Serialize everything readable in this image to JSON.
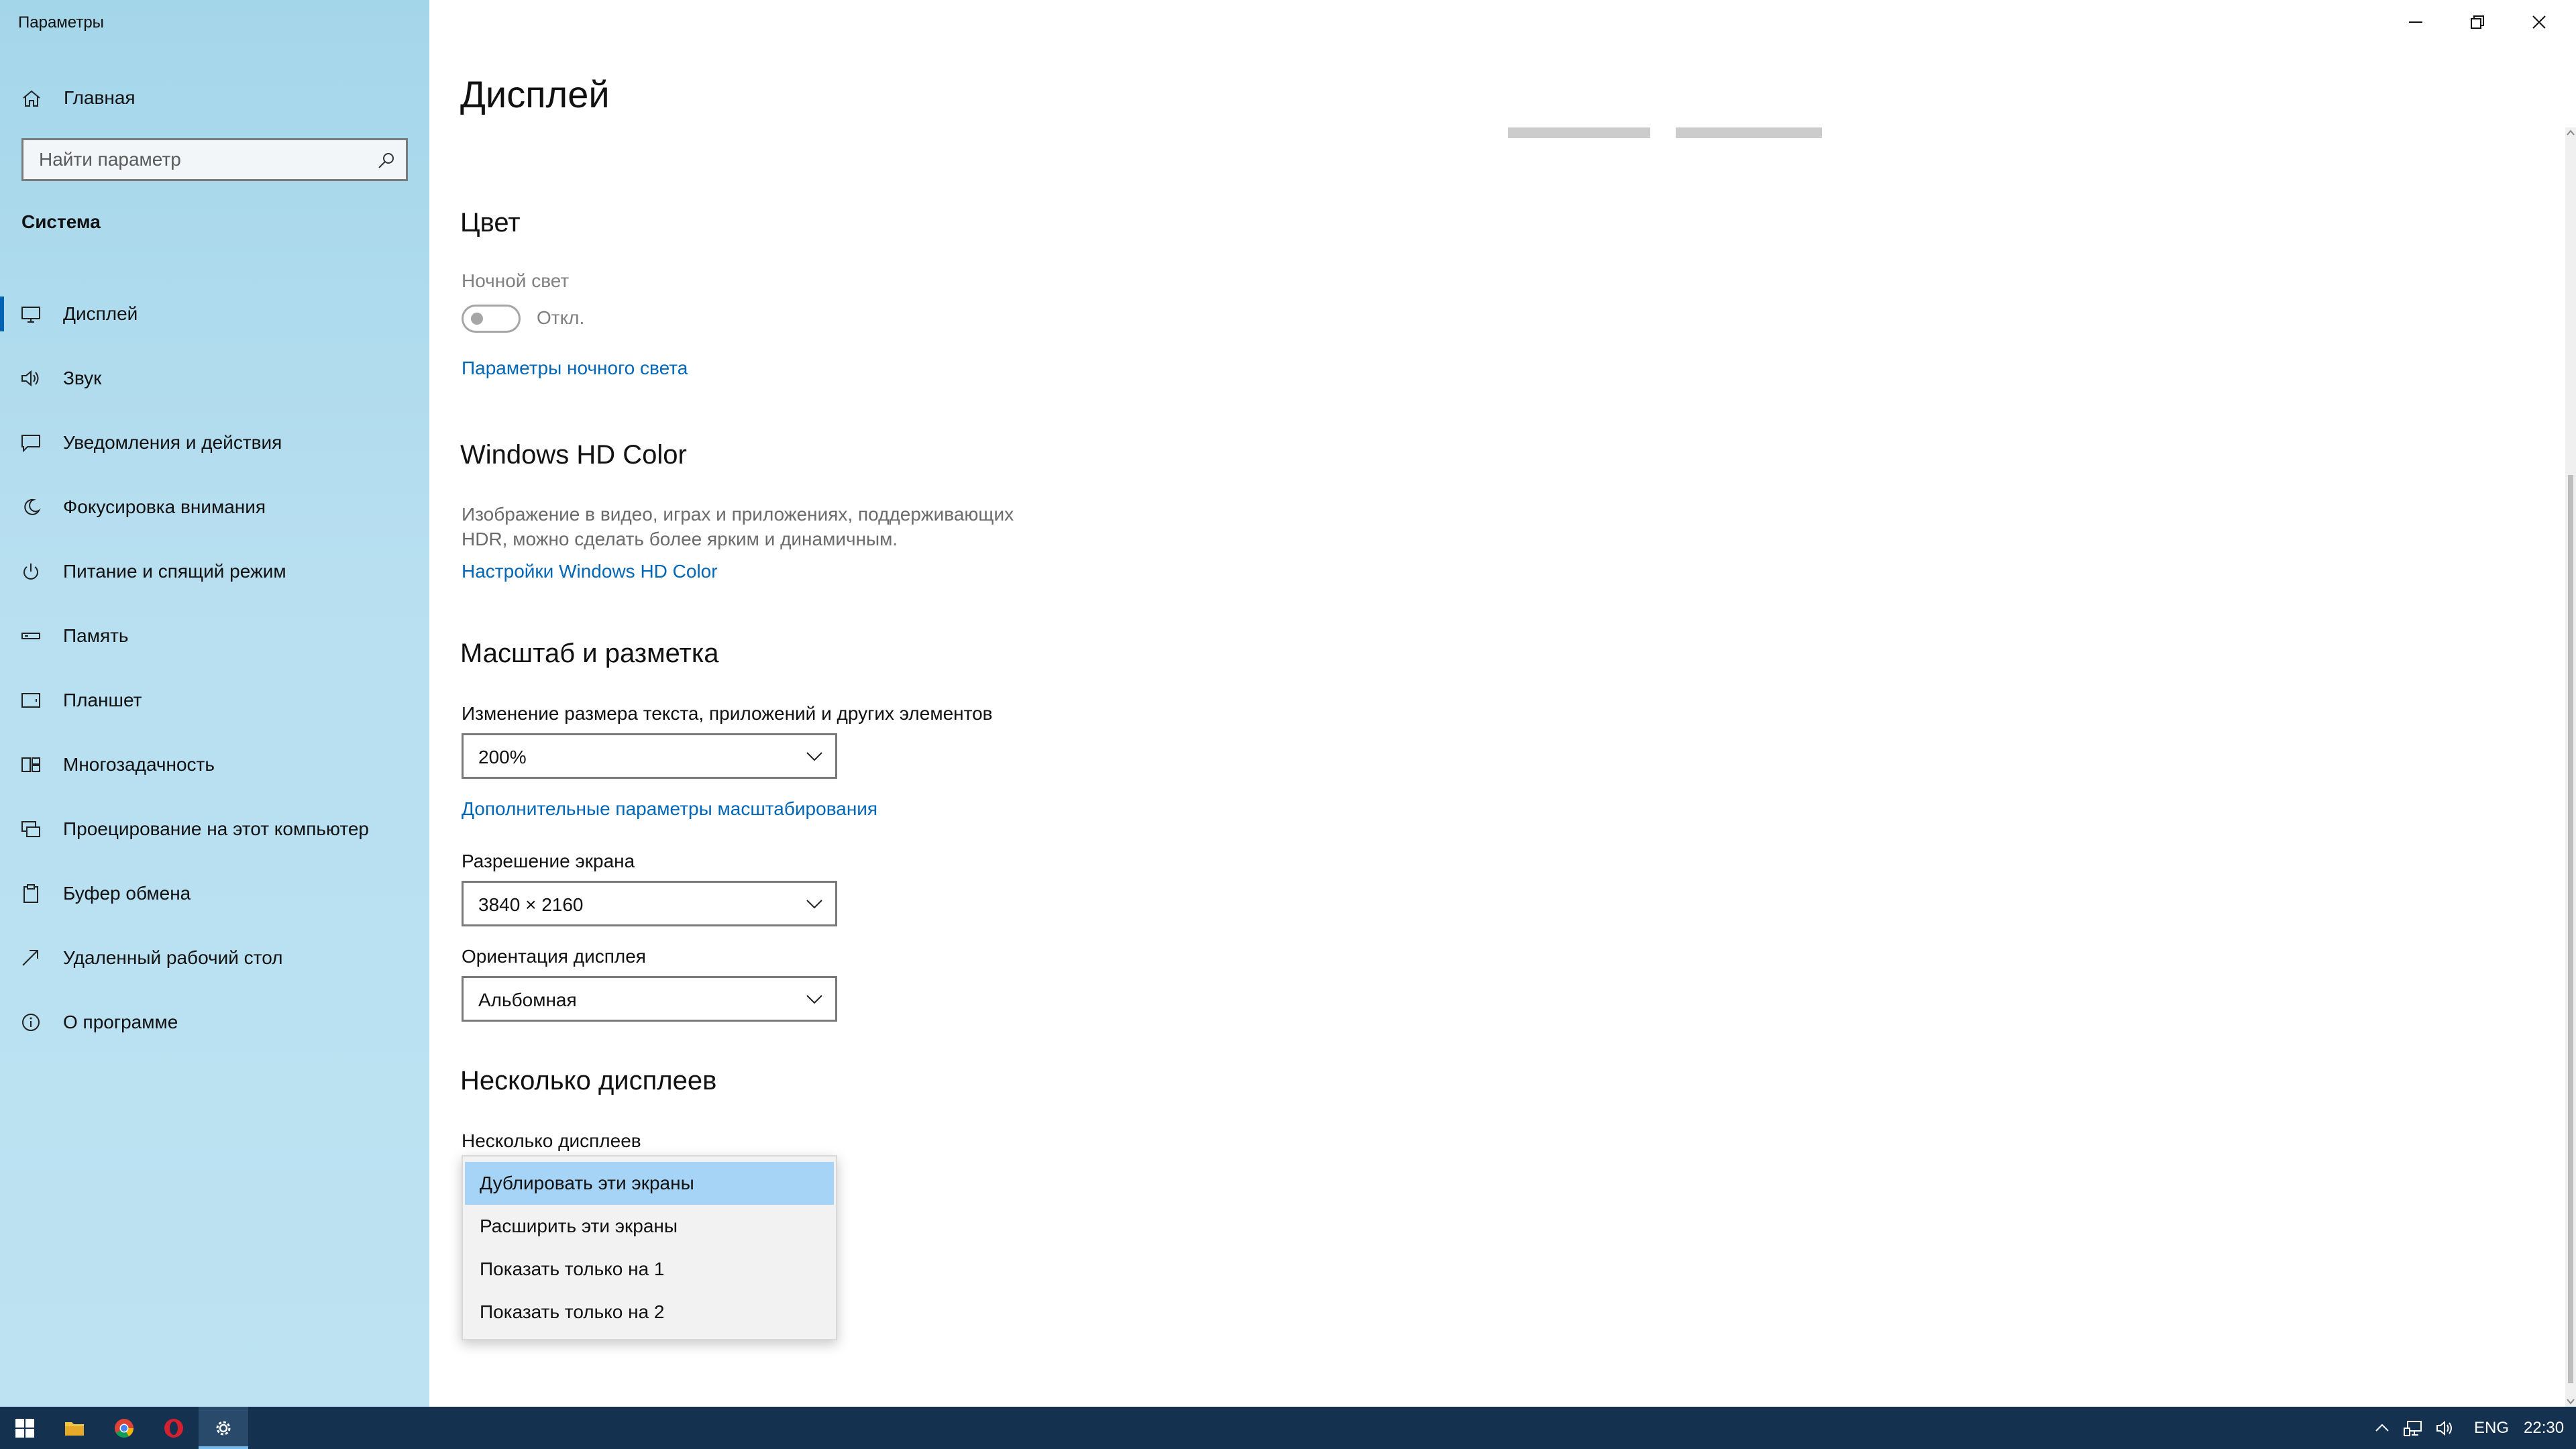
{
  "window": {
    "title": "Параметры"
  },
  "sidebar": {
    "home_label": "Главная",
    "search_placeholder": "Найти параметр",
    "section_label": "Система",
    "items": [
      {
        "label": "Дисплей",
        "icon": "monitor-icon",
        "active": true
      },
      {
        "label": "Звук",
        "icon": "speaker-icon"
      },
      {
        "label": "Уведомления и действия",
        "icon": "notifications-icon"
      },
      {
        "label": "Фокусировка внимания",
        "icon": "moon-icon"
      },
      {
        "label": "Питание и спящий режим",
        "icon": "power-icon"
      },
      {
        "label": "Память",
        "icon": "storage-icon"
      },
      {
        "label": "Планшет",
        "icon": "tablet-icon"
      },
      {
        "label": "Многозадачность",
        "icon": "multitasking-icon"
      },
      {
        "label": "Проецирование на этот компьютер",
        "icon": "projecting-icon"
      },
      {
        "label": "Буфер обмена",
        "icon": "clipboard-icon"
      },
      {
        "label": "Удаленный рабочий стол",
        "icon": "remote-desktop-icon"
      },
      {
        "label": "О программе",
        "icon": "info-icon"
      }
    ]
  },
  "main": {
    "page_title": "Дисплей",
    "color": {
      "heading": "Цвет",
      "night_light_label": "Ночной свет",
      "night_light_state": "Откл.",
      "night_light_on": false,
      "night_light_link": "Параметры ночного света"
    },
    "hdr": {
      "heading": "Windows HD Color",
      "description_line1": "Изображение в видео, играх и приложениях, поддерживающих",
      "description_line2": "HDR, можно сделать более ярким и динамичным.",
      "link": "Настройки Windows HD Color"
    },
    "scale": {
      "heading": "Масштаб и разметка",
      "scale_label": "Изменение размера текста, приложений и других элементов",
      "scale_value": "200%",
      "advanced_link": "Дополнительные параметры масштабирования",
      "resolution_label": "Разрешение экрана",
      "resolution_value": "3840 × 2160",
      "orientation_label": "Ориентация дисплея",
      "orientation_value": "Альбомная"
    },
    "multi": {
      "heading": "Несколько дисплеев",
      "label": "Несколько дисплеев",
      "options": [
        "Дублировать эти экраны",
        "Расширить эти экраны",
        "Показать только на 1",
        "Показать только на 2"
      ],
      "selected_index": 0
    }
  },
  "taskbar": {
    "apps": [
      "start-icon",
      "file-explorer-icon",
      "chrome-icon",
      "opera-icon",
      "settings-icon"
    ],
    "active_app": "settings-icon",
    "language": "ENG",
    "time": "22:30"
  },
  "colors": {
    "accent": "#0063b1",
    "link": "#0067b8",
    "sidebar": "#b7dff0",
    "taskbar": "#14314f",
    "selected_option": "#a6d4f6"
  }
}
